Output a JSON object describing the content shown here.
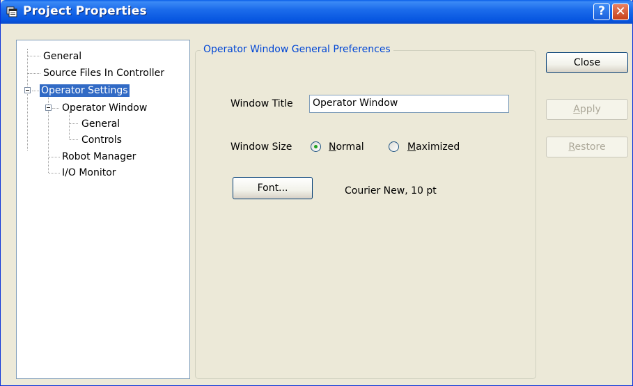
{
  "window": {
    "title": "Project Properties",
    "help_glyph": "?",
    "close_glyph": "✕"
  },
  "tree": {
    "items": [
      {
        "label": "General"
      },
      {
        "label": "Source Files In Controller"
      },
      {
        "label": "Operator Settings",
        "selected": true,
        "expanded": true
      },
      {
        "label": "Operator Window",
        "expanded": true
      },
      {
        "label": "General"
      },
      {
        "label": "Controls"
      },
      {
        "label": "Robot Manager"
      },
      {
        "label": "I/O Monitor"
      }
    ]
  },
  "panel": {
    "group_title": "Operator Window General Preferences",
    "window_title_label": "Window Title",
    "window_title_value": "Operator Window",
    "window_size_label": "Window Size",
    "size_options": {
      "normal_first": "N",
      "normal_rest": "ormal",
      "maximized_first": "M",
      "maximized_rest": "aximized",
      "selected": "Normal"
    },
    "font_button": "Font...",
    "font_value": "Courier New, 10 pt"
  },
  "buttons": {
    "close": "Close",
    "apply_first": "A",
    "apply_rest": "pply",
    "restore_first": "R",
    "restore_rest": "estore"
  },
  "colors": {
    "titlebar": "#0A5FE8",
    "selection": "#316AC5",
    "group_title": "#0046D5",
    "dialog_bg": "#ECE9D8"
  }
}
